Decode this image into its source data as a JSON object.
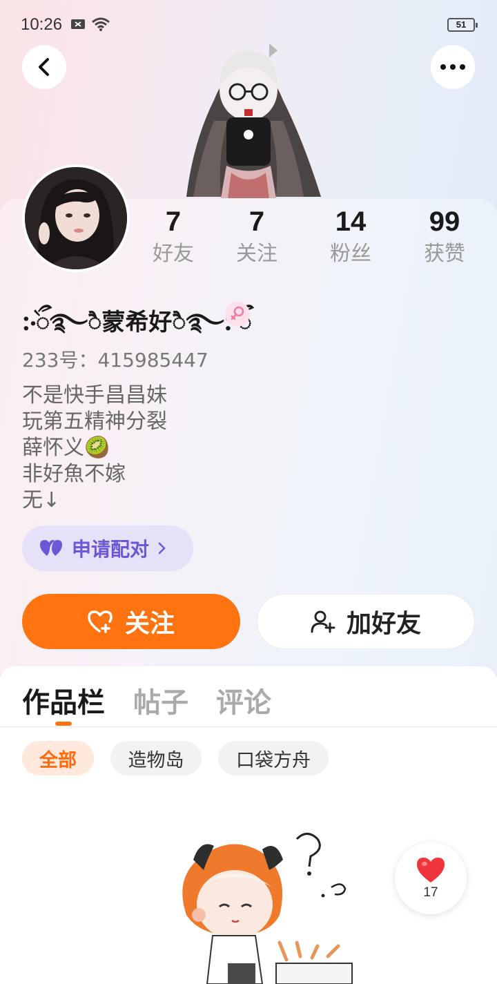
{
  "status_bar": {
    "time": "10:26",
    "battery": "51"
  },
  "profile": {
    "nickname": "჻ᭂ࿐ै蒙希好ै࿐჻ᭂ",
    "uid": "233号：415985447",
    "bio": [
      "不是快手昌昌妹",
      "玩第五精神分裂",
      "薛怀义🥝",
      "非好魚不嫁",
      "无↓"
    ],
    "gender": "female",
    "stats": [
      {
        "value": "7",
        "label": "好友"
      },
      {
        "value": "7",
        "label": "关注"
      },
      {
        "value": "14",
        "label": "粉丝"
      },
      {
        "value": "99",
        "label": "获赞"
      }
    ]
  },
  "actions": {
    "pair_label": "申请配对",
    "follow_label": "关注",
    "add_friend_label": "加好友"
  },
  "tabs": [
    {
      "label": "作品栏",
      "active": true
    },
    {
      "label": "帖子",
      "active": false
    },
    {
      "label": "评论",
      "active": false
    }
  ],
  "filters": [
    {
      "label": "全部",
      "active": true
    },
    {
      "label": "造物岛",
      "active": false
    },
    {
      "label": "口袋方舟",
      "active": false
    }
  ],
  "like_button": {
    "count": "17"
  },
  "colors": {
    "accent": "#ff7411",
    "pair": "#6b57d8",
    "heart": "#f0343c"
  },
  "icons": [
    "back-icon",
    "more-icon",
    "female-icon",
    "heart-pair-icon",
    "heart-plus-icon",
    "add-user-icon",
    "heart-icon"
  ]
}
